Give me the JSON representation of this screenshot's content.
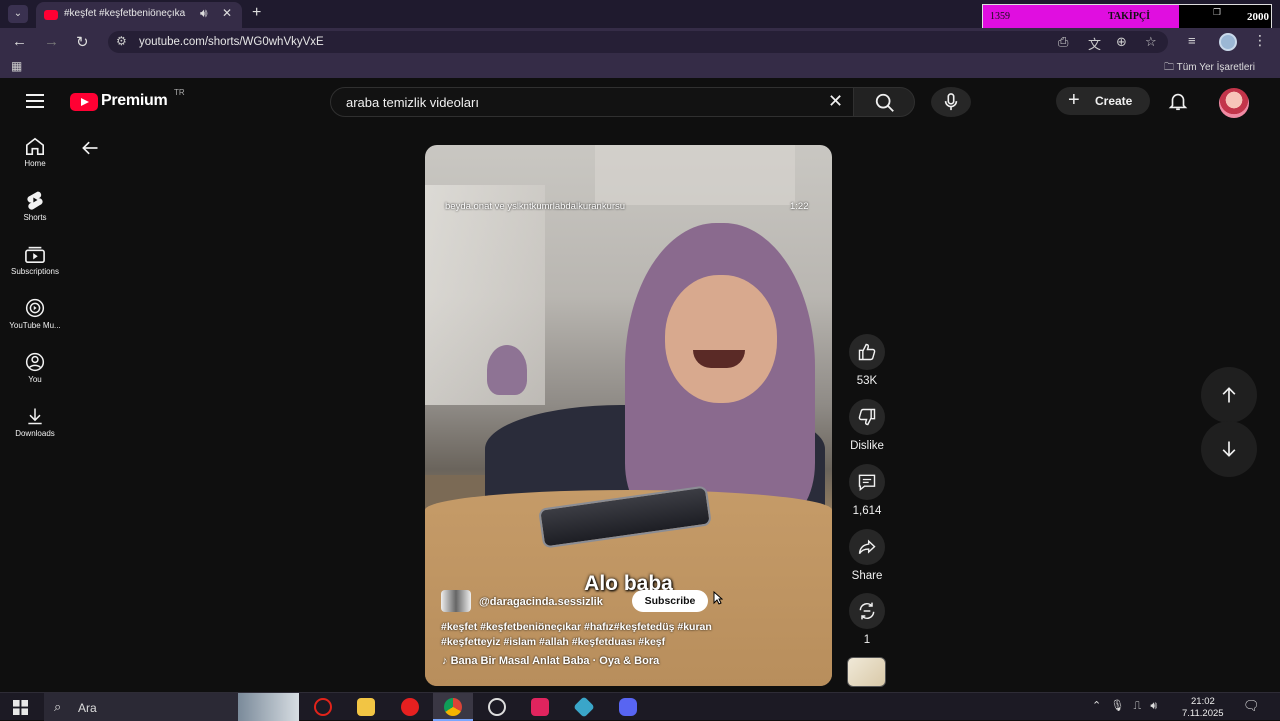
{
  "browser": {
    "tab_title": "#keşfet #keşfetbeniöneçıka",
    "url": "youtube.com/shorts/WG0whVkyVxE",
    "bookmarks_folder": "Tüm Yer İşaretleri"
  },
  "follower_widget": {
    "current": "1359",
    "label": "TAKİPÇİ",
    "target": "2000",
    "progress": 0.68
  },
  "header": {
    "logo_text": "Premium",
    "country": "TR",
    "search_query": "araba temizlik videoları",
    "create_label": "Create"
  },
  "nav": {
    "items": [
      {
        "label": "Home"
      },
      {
        "label": "Shorts"
      },
      {
        "label": "Subscriptions"
      },
      {
        "label": "YouTube Mu..."
      },
      {
        "label": "You"
      },
      {
        "label": "Downloads"
      }
    ]
  },
  "video": {
    "meta_text": "beyda.onat ve yslkntkumrlabdalkurankursu",
    "duration": "1:22",
    "caption": "Alo baba",
    "channel": "@daragacinda.sessizlik",
    "subscribe_label": "Subscribe",
    "hashtags_line1": "#keşfet #keşfetbeniöneçıkar #hafız#keşfetedüş #kuran",
    "hashtags_line2": "#keşfetteyiz #islam #allah #keşfetduası #keşf",
    "music": "Bana Bir Masal Anlat Baba · Oya & Bora"
  },
  "actions": {
    "like_count": "53K",
    "dislike_label": "Dislike",
    "comments_count": "1,614",
    "share_label": "Share",
    "remix_count": "1"
  },
  "taskbar": {
    "search_text": "Ara",
    "time": "21:02",
    "date": "7.11.2025"
  }
}
